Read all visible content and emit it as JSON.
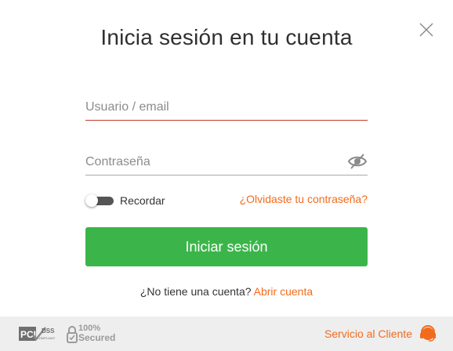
{
  "modal": {
    "title": "Inicia sesión en tu cuenta"
  },
  "form": {
    "username_placeholder": "Usuario / email",
    "username_value": "",
    "password_placeholder": "Contraseña",
    "password_value": "",
    "password_visibility_icon": "eye-slash-icon",
    "remember_label": "Recordar",
    "remember_checked": false,
    "forgot_label": "¿Olvidaste tu contraseña?",
    "submit_label": "Iniciar sesión"
  },
  "signup": {
    "prompt": "¿No tiene una cuenta?",
    "link_label": "Abrir cuenta"
  },
  "footer": {
    "pci_badge_text": "PCI DSS",
    "pci_badge_subtext": "COMPLIANT",
    "secured_line1": "100%",
    "secured_line2": "Secured",
    "service_label": "Servicio al Cliente",
    "service_icon": "headset-icon"
  },
  "colors": {
    "accent": "#f26b1d",
    "primary_button": "#3bb54a",
    "active_underline": "#c0392b",
    "footer_bg": "#eeeeee",
    "title_text": "#2f2f2f"
  }
}
